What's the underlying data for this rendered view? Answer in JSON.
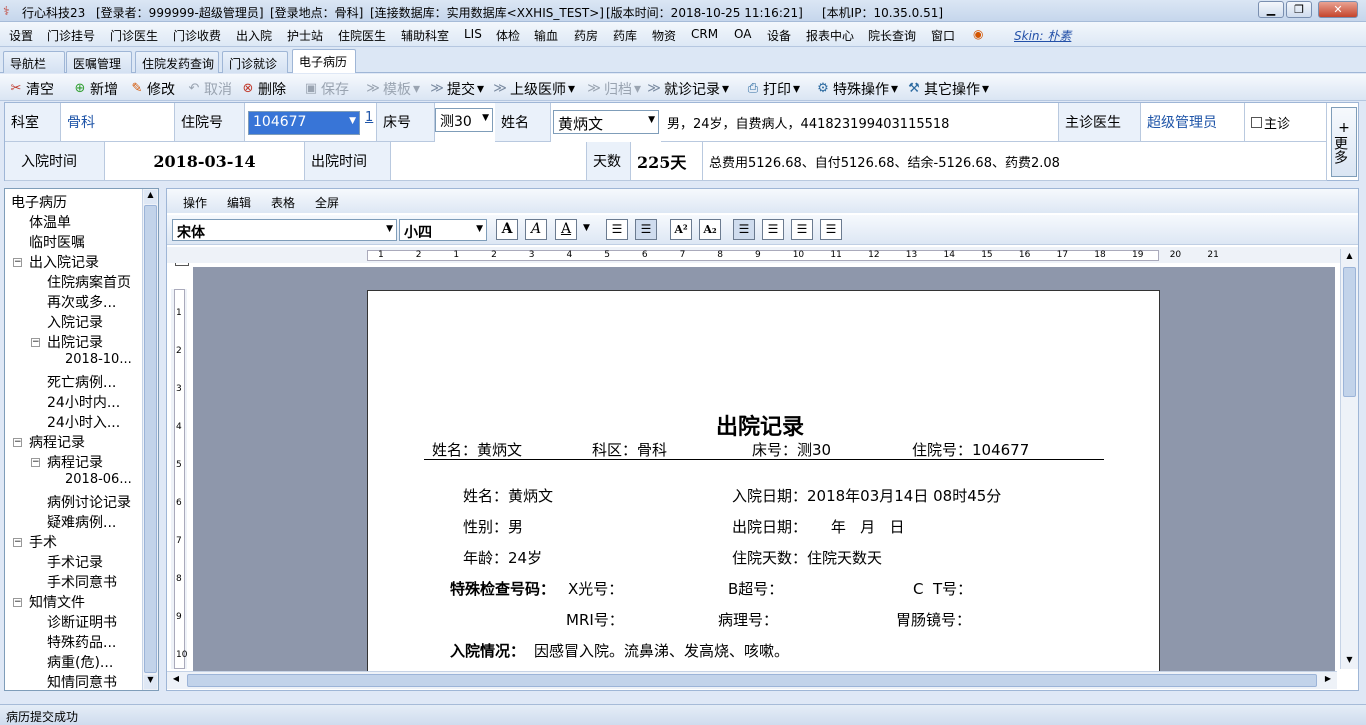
{
  "title_bar": {
    "app": "行心科技23",
    "user": "[登录者：999999-超级管理员]",
    "location": "[登录地点：骨科]",
    "db": "[连接数据库：实用数据库<XXHIS_TEST>]",
    "version": "[版本时间：2018-10-25 11:16:21]",
    "ip": "[本机IP：10.35.0.51]"
  },
  "menu": [
    "设置",
    "门诊挂号",
    "门诊医生",
    "门诊收费",
    "出入院",
    "护士站",
    "住院医生",
    "辅助科室",
    "LIS",
    "体检",
    "输血",
    "药房",
    "药库",
    "物资",
    "CRM",
    "OA",
    "设备",
    "报表中心",
    "院长查询",
    "窗口"
  ],
  "skin": "Skin: 朴素",
  "tabs": [
    "导航栏",
    "医嘱管理",
    "住院发药查询",
    "门诊就诊",
    "电子病历"
  ],
  "toolbar": {
    "clear": "清空",
    "add": "新增",
    "edit": "修改",
    "cancel": "取消",
    "delete": "删除",
    "save": "保存",
    "template": "模板",
    "submit": "提交",
    "senior": "上级医师",
    "archive": "归档",
    "visit_record": "就诊记录",
    "print": "打印",
    "special": "特殊操作",
    "other": "其它操作"
  },
  "patient": {
    "dept_label": "科室",
    "dept": "骨科",
    "inpatient_no_label": "住院号",
    "inpatient_no": "104677",
    "visit_count": "1",
    "bed_label": "床号",
    "bed": "测30",
    "name_label": "姓名",
    "name": "黄炳文",
    "summary": "男，24岁，自费病人，441823199403115518",
    "doctor_label": "主诊医生",
    "doctor": "超级管理员",
    "primary_label": "主诊",
    "admit_label": "入院时间",
    "admit_date": "2018-03-14",
    "discharge_label": "出院时间",
    "discharge_date": "",
    "days_label": "天数",
    "days": "225天",
    "fees": "总费用5126.68、自付5126.68、结余-5126.68、药费2.08",
    "more": "更多"
  },
  "tree": [
    {
      "label": "电子病历",
      "level": 0,
      "exp": ""
    },
    {
      "label": "体温单",
      "level": 1,
      "exp": ""
    },
    {
      "label": "临时医嘱",
      "level": 1,
      "exp": ""
    },
    {
      "label": "出入院记录",
      "level": 1,
      "exp": "−"
    },
    {
      "label": "住院病案首页",
      "level": 2,
      "exp": ""
    },
    {
      "label": "再次或多...",
      "level": 2,
      "exp": ""
    },
    {
      "label": "入院记录",
      "level": 2,
      "exp": ""
    },
    {
      "label": "出院记录",
      "level": 2,
      "exp": "−"
    },
    {
      "label": "2018-10...",
      "level": 3,
      "exp": ""
    },
    {
      "label": "死亡病例...",
      "level": 2,
      "exp": ""
    },
    {
      "label": "24小时内...",
      "level": 2,
      "exp": ""
    },
    {
      "label": "24小时入...",
      "level": 2,
      "exp": ""
    },
    {
      "label": "病程记录",
      "level": 1,
      "exp": "−"
    },
    {
      "label": "病程记录",
      "level": 2,
      "exp": "−"
    },
    {
      "label": "2018-06...",
      "level": 3,
      "exp": ""
    },
    {
      "label": "病例讨论记录",
      "level": 2,
      "exp": ""
    },
    {
      "label": "疑难病例...",
      "level": 2,
      "exp": ""
    },
    {
      "label": "手术",
      "level": 1,
      "exp": "−"
    },
    {
      "label": "手术记录",
      "level": 2,
      "exp": ""
    },
    {
      "label": "手术同意书",
      "level": 2,
      "exp": ""
    },
    {
      "label": "知情文件",
      "level": 1,
      "exp": "−"
    },
    {
      "label": "诊断证明书",
      "level": 2,
      "exp": ""
    },
    {
      "label": "特殊药品...",
      "level": 2,
      "exp": ""
    },
    {
      "label": "病重(危)...",
      "level": 2,
      "exp": ""
    },
    {
      "label": "知情同意书",
      "level": 2,
      "exp": ""
    }
  ],
  "editor": {
    "menu": [
      "操作",
      "编辑",
      "表格",
      "全屏"
    ],
    "font": "宋体",
    "size": "小四",
    "ruler_marks": [
      "1",
      "2",
      "1",
      "2",
      "3",
      "4",
      "5",
      "6",
      "7",
      "8",
      "9",
      "10",
      "11",
      "12",
      "13",
      "14",
      "15",
      "16",
      "17",
      "18",
      "19",
      "20",
      "21"
    ],
    "vruler_marks": [
      "1",
      "2",
      "3",
      "4",
      "5",
      "6",
      "7",
      "8",
      "9",
      "10"
    ]
  },
  "document": {
    "title": "出院记录",
    "header_name": "姓名：黄炳文",
    "header_dept": "科区：骨科",
    "header_bed": "床号：测30",
    "header_no": "住院号：104677",
    "name": "姓名：黄炳文",
    "admit": "入院日期：2018年03月14日 08时45分",
    "sex": "性别：男",
    "discharge": "出院日期：     年   月   日",
    "age": "年龄：24岁",
    "stay_days": "住院天数：住院天数天",
    "special_label": "特殊检查号码：",
    "xray": "X光号：",
    "bscan": "B超号：",
    "ct": "C  T号：",
    "mri": "MRI号：",
    "pathology": "病理号：",
    "gastro": "胃肠镜号：",
    "admission_label": "入院情况：",
    "admission_text": "因感冒入院。流鼻涕、发高烧、咳嗽。"
  },
  "status": "病历提交成功"
}
